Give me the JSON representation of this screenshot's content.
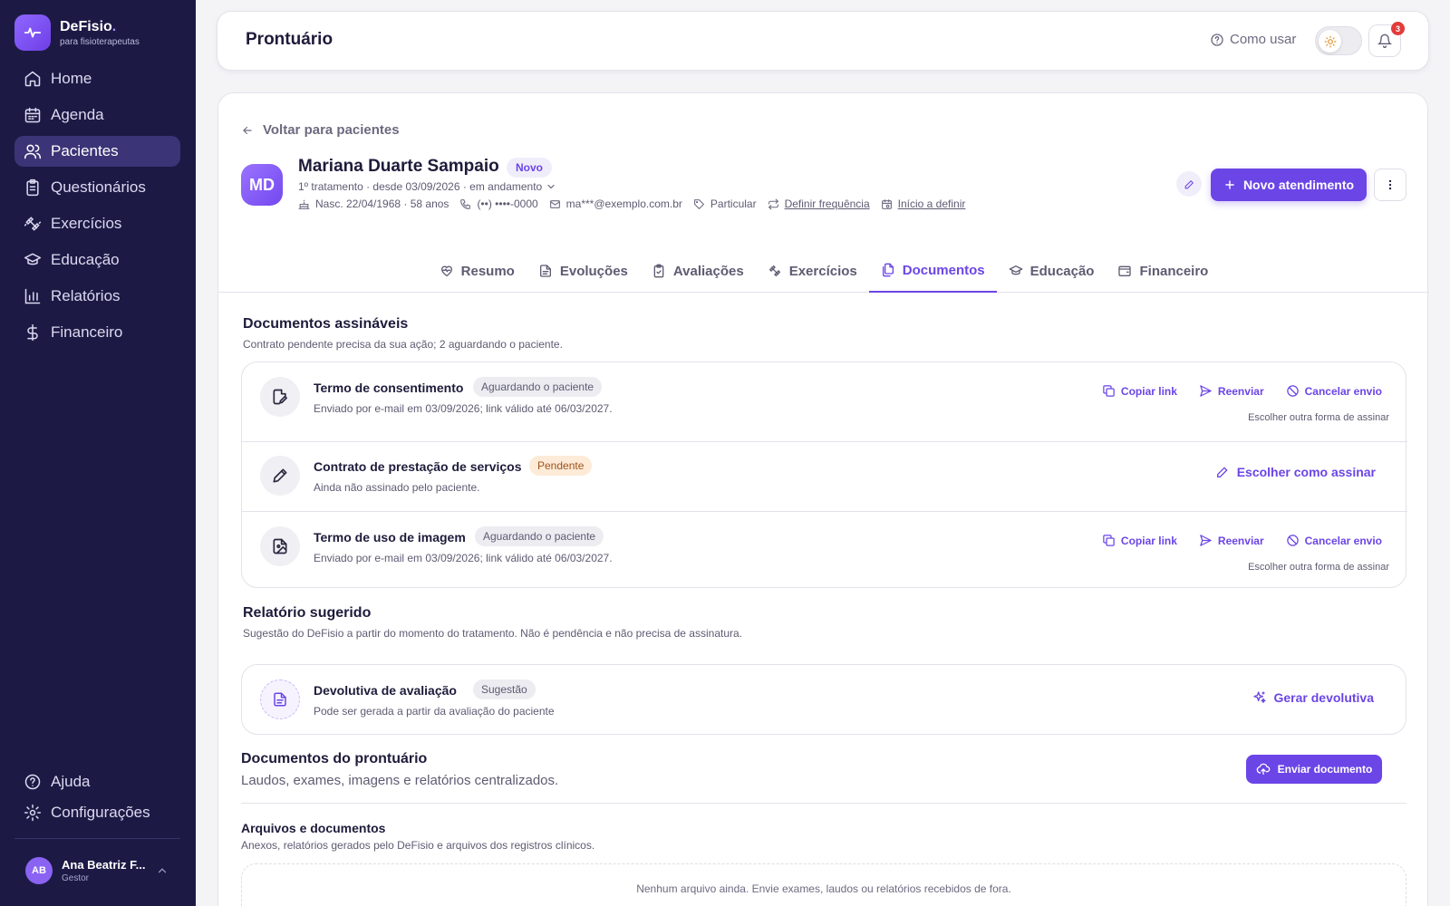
{
  "app": {
    "name": "DeFisio",
    "name_dot": ".",
    "tagline": "para fisioterapeutas",
    "accent_color": "#6b45e6",
    "sidebar_bg": "#1c1a45"
  },
  "sidebar": {
    "items": [
      {
        "label": "Home",
        "icon": "home-icon"
      },
      {
        "label": "Agenda",
        "icon": "calendar-icon"
      },
      {
        "label": "Pacientes",
        "icon": "users-icon",
        "active": true
      },
      {
        "label": "Questionários",
        "icon": "clipboard-icon"
      },
      {
        "label": "Exercícios",
        "icon": "dumbbell-icon"
      },
      {
        "label": "Educação",
        "icon": "graduation-cap-icon"
      },
      {
        "label": "Relatórios",
        "icon": "bar-chart-icon"
      },
      {
        "label": "Financeiro",
        "icon": "dollar-icon"
      }
    ],
    "bottom": [
      {
        "label": "Ajuda",
        "icon": "help-circle-icon"
      },
      {
        "label": "Configurações",
        "icon": "gear-icon"
      }
    ],
    "user": {
      "initials": "AB",
      "name": "Ana Beatriz F...",
      "role": "Gestor"
    }
  },
  "header": {
    "title": "Prontuário",
    "help_label": "Como usar",
    "notifications_count": "3"
  },
  "patient": {
    "back_label": "Voltar para pacientes",
    "initials": "MD",
    "name": "Mariana Duarte Sampaio",
    "badge": "Novo",
    "treatment_line": "1º tratamento · desde 03/09/2026 · em andamento",
    "birth": "Nasc. 22/04/1968 · 58 anos",
    "phone": "(••) ••••-0000",
    "email": "ma***@exemplo.com.br",
    "plan": "Particular",
    "frequency": "Definir frequência",
    "start": "Início a definir",
    "new_button": "Novo atendimento"
  },
  "tabs": [
    {
      "label": "Resumo",
      "icon": "heart-pulse-icon"
    },
    {
      "label": "Evoluções",
      "icon": "file-text-icon"
    },
    {
      "label": "Avaliações",
      "icon": "clipboard-check-icon"
    },
    {
      "label": "Exercícios",
      "icon": "dumbbell-icon"
    },
    {
      "label": "Documentos",
      "icon": "files-icon",
      "active": true
    },
    {
      "label": "Educação",
      "icon": "graduation-cap-icon"
    },
    {
      "label": "Financeiro",
      "icon": "wallet-icon"
    }
  ],
  "signable": {
    "title": "Documentos assináveis",
    "subtitle": "Contrato pendente precisa da sua ação; 2 aguardando o paciente.",
    "docs": [
      {
        "title": "Termo de consentimento",
        "status": "Aguardando o paciente",
        "detail": "Enviado por e-mail em 03/09/2026; link válido até 06/03/2027.",
        "actions": [
          "Copiar link",
          "Reenviar",
          "Cancelar envio"
        ],
        "alt": "Escolher outra forma de assinar"
      },
      {
        "title": "Contrato de prestação de serviços",
        "status": "Pendente",
        "detail": "Ainda não assinado pelo paciente.",
        "action": "Escolher como assinar"
      },
      {
        "title": "Termo de uso de imagem",
        "status": "Aguardando o paciente",
        "detail": "Enviado por e-mail em 03/09/2026; link válido até 06/03/2027.",
        "actions": [
          "Copiar link",
          "Reenviar",
          "Cancelar envio"
        ],
        "alt": "Escolher outra forma de assinar"
      }
    ]
  },
  "suggested": {
    "title": "Relatório sugerido",
    "subtitle": "Sugestão do DeFisio a partir do momento do tratamento. Não é pendência e não precisa de assinatura.",
    "doc_title": "Devolutiva de avaliação",
    "doc_status": "Sugestão",
    "doc_detail": "Pode ser gerada a partir da avaliação do paciente",
    "action": "Gerar devolutiva"
  },
  "records": {
    "title": "Documentos do prontuário",
    "subtitle": "Laudos, exames, imagens e relatórios centralizados.",
    "send_button": "Enviar documento",
    "files_title": "Arquivos e documentos",
    "files_subtitle": "Anexos, relatórios gerados pelo DeFisio e arquivos dos registros clínicos.",
    "empty": "Nenhum arquivo ainda. Envie exames, laudos ou relatórios recebidos de fora."
  }
}
